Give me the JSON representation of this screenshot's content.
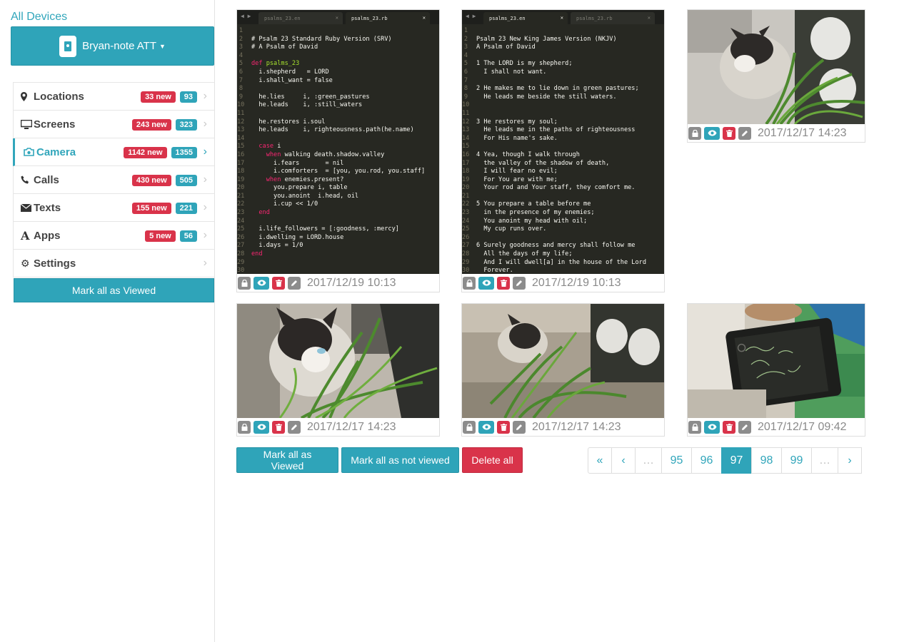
{
  "sidebar": {
    "all_devices_link": "All Devices",
    "device": {
      "name": "Bryan-note ATT",
      "icon": "tablet-icon"
    },
    "nav": [
      {
        "label": "Locations",
        "icon": "map-pin-icon",
        "new": "33 new",
        "count": "93",
        "active": false
      },
      {
        "label": "Screens",
        "icon": "monitor-icon",
        "new": "243 new",
        "count": "323",
        "active": false
      },
      {
        "label": "Camera",
        "icon": "camera-icon",
        "new": "1142 new",
        "count": "1355",
        "active": true
      },
      {
        "label": "Calls",
        "icon": "phone-icon",
        "new": "430 new",
        "count": "505",
        "active": false
      },
      {
        "label": "Texts",
        "icon": "envelope-icon",
        "new": "155 new",
        "count": "221",
        "active": false
      },
      {
        "label": "Apps",
        "icon": "font-icon",
        "new": "5 new",
        "count": "56",
        "active": false
      },
      {
        "label": "Settings",
        "icon": "gear-icon",
        "new": "",
        "count": "",
        "active": false
      }
    ],
    "mark_all_label": "Mark all as Viewed"
  },
  "gallery": {
    "items": [
      {
        "timestamp": "2017/12/19 10:13",
        "kind": "editor-ruby"
      },
      {
        "timestamp": "2017/12/19 10:13",
        "kind": "editor-text"
      },
      {
        "timestamp": "2017/12/17 14:23",
        "kind": "photo-cat"
      },
      {
        "timestamp": "2017/12/17 14:23",
        "kind": "photo-cat"
      },
      {
        "timestamp": "2017/12/17 14:23",
        "kind": "photo-cat"
      },
      {
        "timestamp": "2017/12/17 09:42",
        "kind": "photo-tablet"
      }
    ],
    "editor_ruby": {
      "tabs": [
        "psalms_23.en",
        "psalms_23.rb"
      ],
      "active_tab": 1,
      "lines": [
        "",
        "# Psalm 23 Standard Ruby Version (SRV)",
        "# A Psalm of David",
        "",
        "def psalms_23",
        "  i.shepherd   = LORD",
        "  i.shall_want = false",
        "",
        "  he.lies     i, :green_pastures",
        "  he.leads    i, :still_waters",
        "",
        "  he.restores i.soul",
        "  he.leads    i, righteousness.path(he.name)",
        "",
        "  case i",
        "    when walking death.shadow.valley",
        "      i.fears       = nil",
        "      i.comforters  = [you, you.rod, you.staff]",
        "    when enemies.present?",
        "      you.prepare i, table",
        "      you.anoint  i.head, oil",
        "      i.cup << 1/0",
        "  end",
        "",
        "  i.life_followers = [:goodness, :mercy]",
        "  i.dwelling = LORD.house",
        "  i.days = 1/0",
        "end",
        "",
        ""
      ]
    },
    "editor_text": {
      "tabs": [
        "psalms_23.en",
        "psalms_23.rb"
      ],
      "active_tab": 0,
      "lines": [
        "",
        "Psalm 23 New King James Version (NKJV)",
        "A Psalm of David",
        "",
        "1 The LORD is my shepherd;",
        "  I shall not want.",
        "",
        "2 He makes me to lie down in green pastures;",
        "  He leads me beside the still waters.",
        "",
        "",
        "3 He restores my soul;",
        "  He leads me in the paths of righteousness",
        "  For His name's sake.",
        "",
        "4 Yea, though I walk through",
        "  the valley of the shadow of death,",
        "  I will fear no evil;",
        "  For You are with me;",
        "  Your rod and Your staff, they comfort me.",
        "",
        "5 You prepare a table before me",
        "  in the presence of my enemies;",
        "  You anoint my head with oil;",
        "  My cup runs over.",
        "",
        "6 Surely goodness and mercy shall follow me",
        "  All the days of my life;",
        "  And I will dwell[a] in the house of the Lord",
        "  Forever."
      ]
    }
  },
  "actions": {
    "mark_viewed": "Mark all as Viewed",
    "mark_not_viewed": "Mark all as not viewed",
    "delete_all": "Delete all"
  },
  "pagination": {
    "first": "«",
    "prev": "‹",
    "ellipsis": "…",
    "pages": [
      "95",
      "96",
      "97",
      "98",
      "99"
    ],
    "current": "97",
    "next": "›"
  },
  "colors": {
    "accent": "#2fa4b9",
    "danger": "#d9334a",
    "muted": "#8c8c8c"
  }
}
